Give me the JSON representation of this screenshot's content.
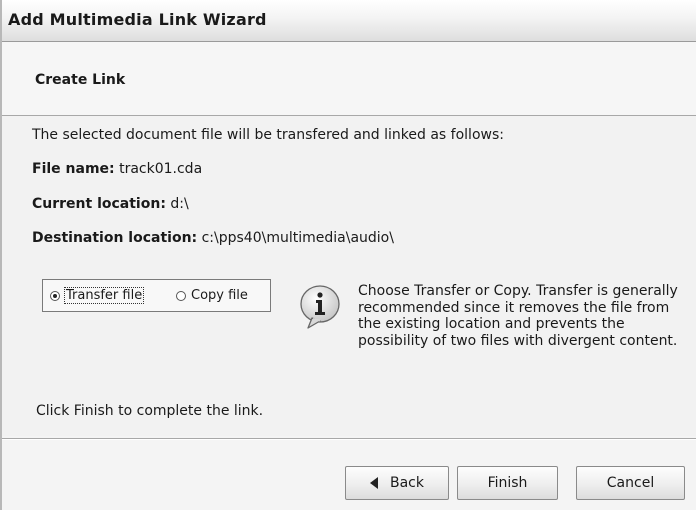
{
  "window": {
    "title": "Add Multimedia Link Wizard"
  },
  "header": {
    "title": "Create Link"
  },
  "content": {
    "intro": "The selected document file will be transfered and linked as follows:",
    "file_name_label": "File name:",
    "file_name_value": "track01.cda",
    "current_location_label": "Current location:",
    "current_location_value": "d:\\",
    "destination_location_label": "Destination location:",
    "destination_location_value": "c:\\pps40\\multimedia\\audio\\",
    "options": [
      {
        "label": "Transfer file",
        "selected": true
      },
      {
        "label": "Copy file",
        "selected": false
      }
    ],
    "info_icon": "info-icon",
    "info_text": "Choose Transfer or Copy.  Transfer is generally recommended since it removes the file from the existing location and prevents the possibility of two files with divergent content.",
    "finish_note": "Click Finish to complete the link."
  },
  "buttons": {
    "back": "Back",
    "finish": "Finish",
    "cancel": "Cancel"
  }
}
